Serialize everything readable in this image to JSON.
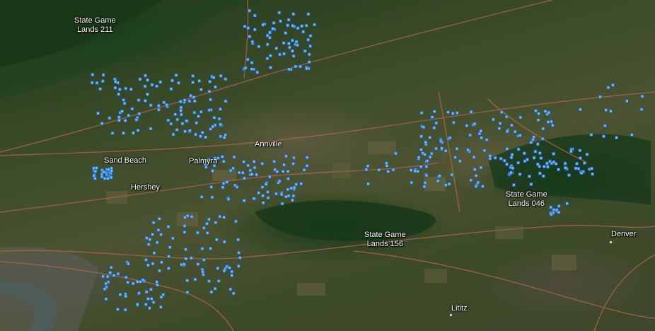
{
  "map": {
    "colors": {
      "point_fill": "#6fb6ff",
      "point_stroke": "#1a5fb0",
      "road": "#b0654a",
      "river": "#3d5a5a",
      "label_text": "#ffffff"
    },
    "labels": {
      "sgl_211": "State Game\nLands 211",
      "sand_beach": "Sand Beach",
      "palmyra": "Palmyra",
      "annville": "Annville",
      "hershey": "Hershey",
      "sgl_046": "State Game\nLands 046",
      "sgl_156": "State Game\nLands 156",
      "denver": "Denver",
      "lititz": "Lititz"
    }
  }
}
